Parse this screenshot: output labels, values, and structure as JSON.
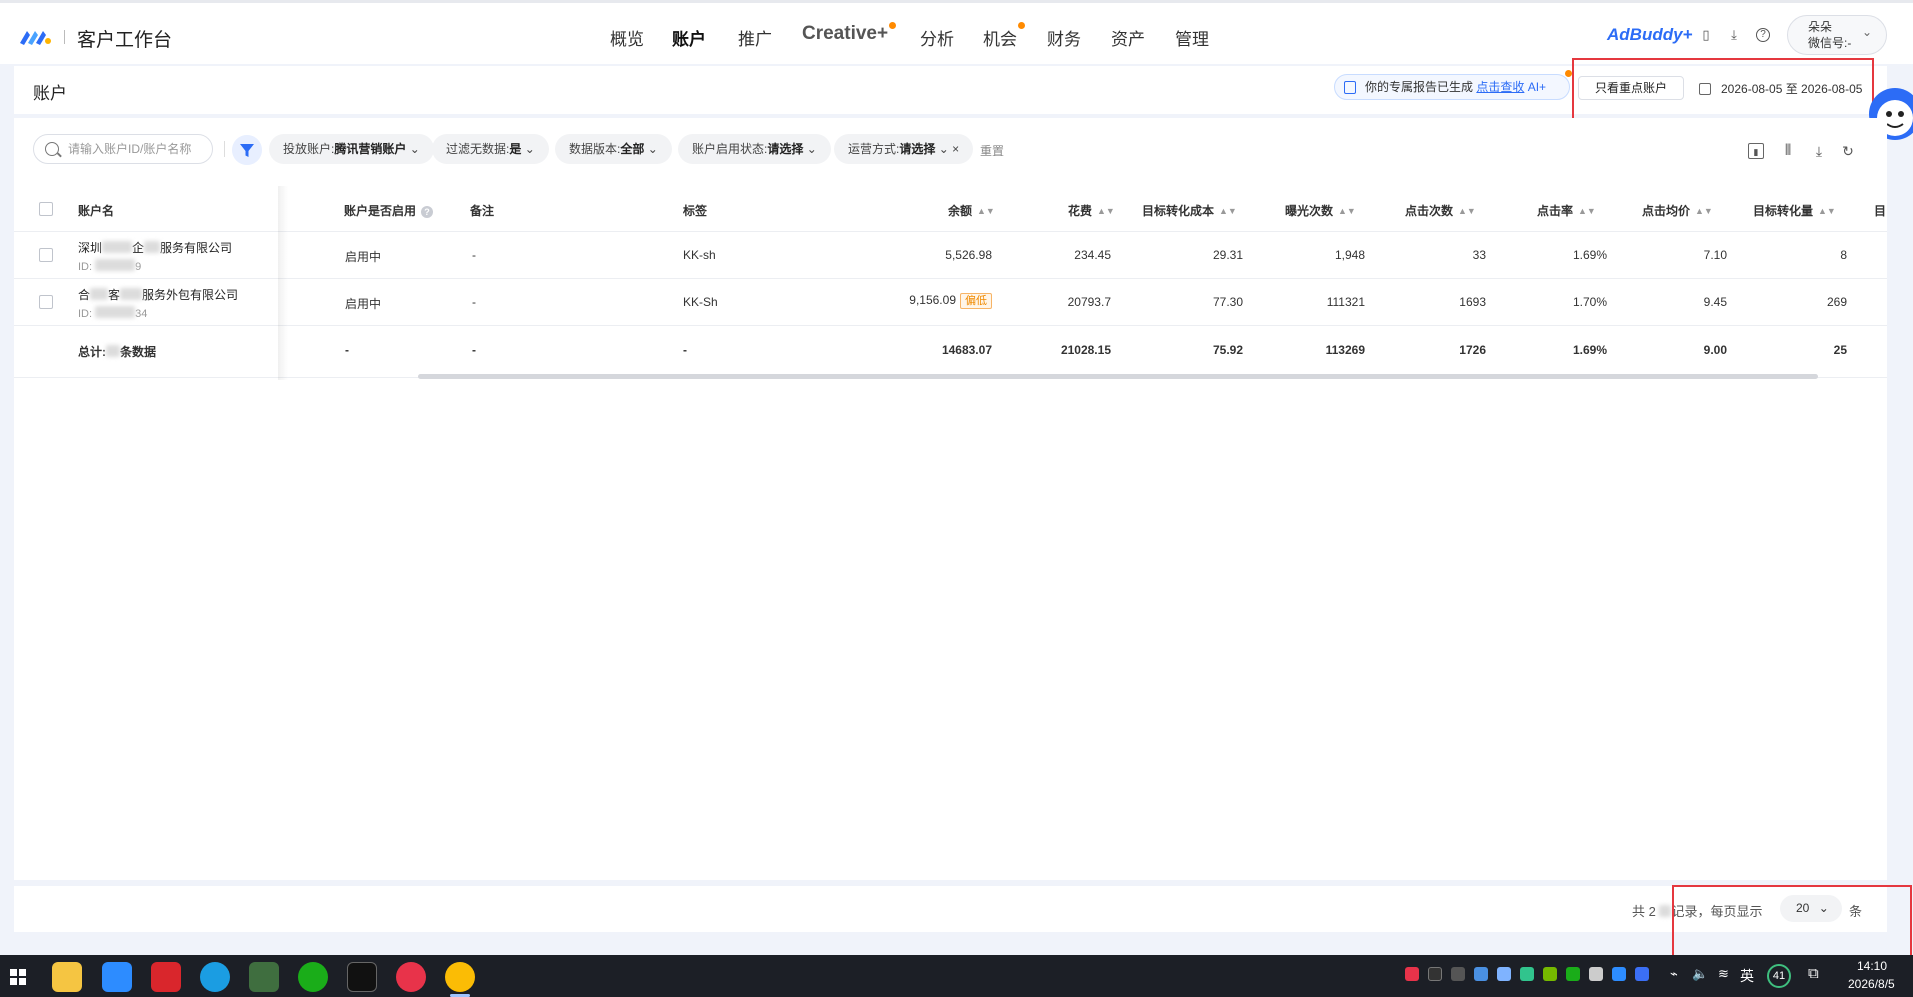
{
  "header": {
    "app_title": "客户工作台",
    "nav": [
      "概览",
      "账户",
      "推广",
      "Creative+",
      "分析",
      "机会",
      "财务",
      "资产",
      "管理"
    ],
    "brand": "AdBuddy+",
    "user_name": "朵朵",
    "user_wechat": "微信号:-"
  },
  "titlebar": {
    "page_title": "账户",
    "report_text": "你的专属报告已生成",
    "report_link": "点击查收",
    "report_ai": "AI+",
    "key_accounts_btn": "只看重点账户",
    "date_range": "2026-08-05 至 2026-08-05"
  },
  "filters": {
    "search_placeholder": "请输入账户ID/账户名称",
    "chips": [
      {
        "label": "投放账户:",
        "value": "腾讯营销账户"
      },
      {
        "label": "过滤无数据:",
        "value": "是"
      },
      {
        "label": "数据版本:",
        "value": "全部"
      },
      {
        "label": "账户启用状态:",
        "value": "请选择"
      },
      {
        "label": "运营方式:",
        "value": "请选择"
      }
    ],
    "reset": "重置"
  },
  "table": {
    "columns": [
      "账户名",
      "账户是否启用",
      "备注",
      "标签",
      "余额",
      "花费",
      "目标转化成本",
      "曝光次数",
      "点击次数",
      "点击率",
      "点击均价",
      "目标转化量",
      "目"
    ],
    "rows": [
      {
        "name_a": "深圳",
        "name_b": "企",
        "name_c": "服务有限公司",
        "id_prefix": "ID: ",
        "id_suffix": "9",
        "enabled": "启用中",
        "note": "-",
        "tag": "KK-sh",
        "balance": "5,526.98",
        "balance_flag": "",
        "spend": "234.45",
        "cpa": "29.31",
        "impressions": "1,948",
        "clicks": "33",
        "ctr": "1.69%",
        "cpc": "7.10",
        "conversions": "8"
      },
      {
        "name_a": "合",
        "name_b": "客",
        "name_c": "服务外包有限公司",
        "id_prefix": "ID: ",
        "id_suffix": "34",
        "enabled": "启用中",
        "note": "-",
        "tag": "KK-Sh",
        "balance": "9,156.09",
        "balance_flag": "偏低",
        "spend": "20793.7",
        "cpa": "77.30",
        "impressions": "111321",
        "clicks": "1693",
        "ctr": "1.70%",
        "cpc": "9.45",
        "conversions": "269"
      }
    ],
    "total": {
      "label_a": "总计:",
      "label_b": "条数据",
      "enabled": "-",
      "note": "-",
      "tag": "-",
      "balance": "14683.07",
      "spend": "21028.15",
      "cpa": "75.92",
      "impressions": "113269",
      "clicks": "1726",
      "ctr": "1.69%",
      "cpc": "9.00",
      "conversions": "25"
    }
  },
  "pagination": {
    "total_text_a": "共 2 ",
    "total_text_b": "记录，每页显示",
    "page_size": "20",
    "unit": "条"
  },
  "taskbar": {
    "ime": "英",
    "badge": "41",
    "time": "14:10",
    "date": "2026/8/5"
  },
  "colors": {
    "accent": "#2c6cf6",
    "warning": "#ff8a00",
    "highlight_box": "#e5383f"
  }
}
